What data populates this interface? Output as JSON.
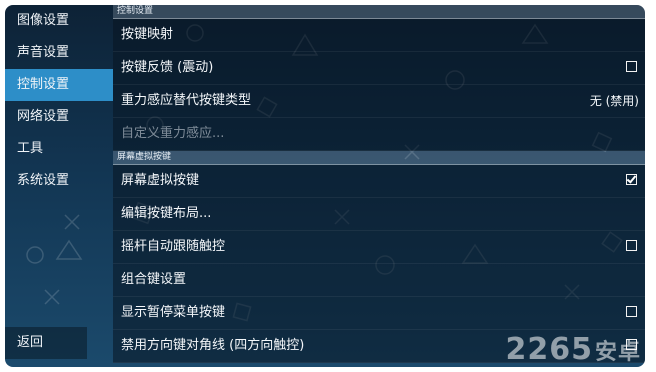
{
  "sidebar": {
    "items": [
      {
        "label": "图像设置",
        "active": false
      },
      {
        "label": "声音设置",
        "active": false
      },
      {
        "label": "控制设置",
        "active": true
      },
      {
        "label": "网络设置",
        "active": false
      },
      {
        "label": "工具",
        "active": false
      },
      {
        "label": "系统设置",
        "active": false
      }
    ],
    "back_label": "返回"
  },
  "sections": [
    {
      "header": "控制设置",
      "rows": [
        {
          "label": "按键映射",
          "control": "none"
        },
        {
          "label": "按键反馈 (震动)",
          "control": "checkbox",
          "checked": false
        },
        {
          "label": "重力感应替代按键类型",
          "control": "value",
          "value": "无 (禁用)"
        },
        {
          "label": "自定义重力感应...",
          "control": "none",
          "disabled": true
        }
      ]
    },
    {
      "header": "屏幕虚拟按键",
      "rows": [
        {
          "label": "屏幕虚拟按键",
          "control": "checkbox",
          "checked": true
        },
        {
          "label": "编辑按键布局...",
          "control": "none"
        },
        {
          "label": "摇杆自动跟随触控",
          "control": "checkbox",
          "checked": false
        },
        {
          "label": "组合键设置",
          "control": "none"
        },
        {
          "label": "显示暂停菜单按键",
          "control": "checkbox",
          "checked": false
        },
        {
          "label": "禁用方向键对角线 (四方向触控)",
          "control": "checkbox",
          "checked": false
        }
      ]
    }
  ],
  "watermark": {
    "number": "2265",
    "suffix": "安卓"
  },
  "colors": {
    "accent": "#2d8ec8",
    "background": "#123552"
  }
}
